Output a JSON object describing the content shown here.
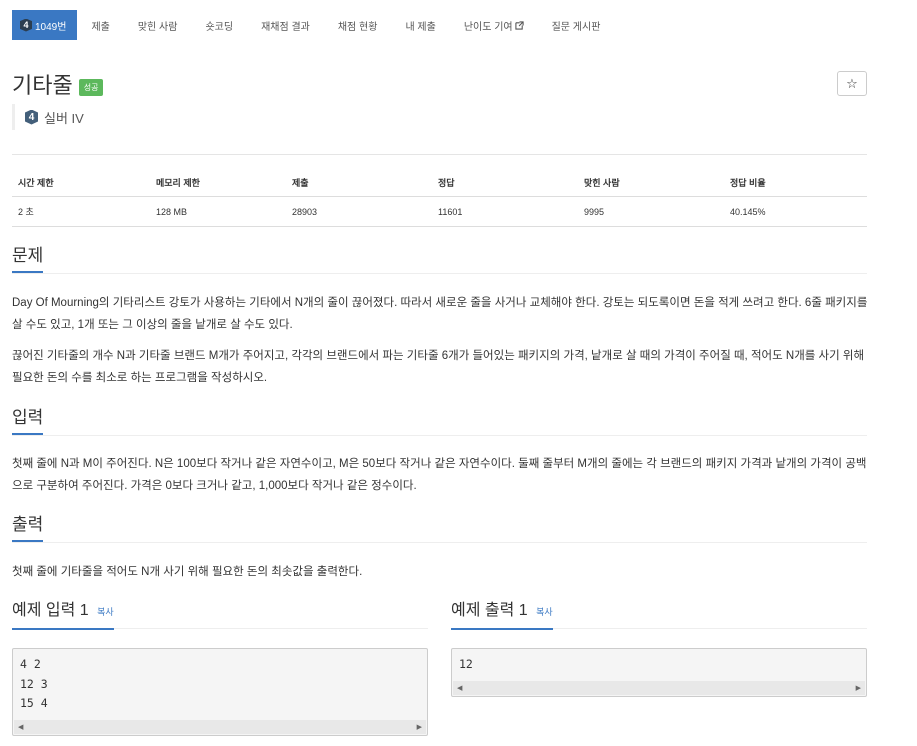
{
  "tabs": [
    {
      "label": "1049번",
      "tier_num": "4",
      "active": true
    },
    {
      "label": "제출"
    },
    {
      "label": "맞힌 사람"
    },
    {
      "label": "숏코딩"
    },
    {
      "label": "재채점 결과"
    },
    {
      "label": "채점 현황"
    },
    {
      "label": "내 제출"
    },
    {
      "label": "난이도 기여",
      "external": true
    },
    {
      "label": "질문 게시판"
    }
  ],
  "problem": {
    "title": "기타줄",
    "result_label": "성공",
    "tier_num": "4",
    "tier_label": "실버 IV",
    "favorite_icon": "☆"
  },
  "info_table": {
    "headers": [
      "시간 제한",
      "메모리 제한",
      "제출",
      "정답",
      "맞힌 사람",
      "정답 비율"
    ],
    "row": [
      "2 초",
      "128 MB",
      "28903",
      "11601",
      "9995",
      "40.145%"
    ]
  },
  "sections": {
    "problem_heading": "문제",
    "problem_p1": "Day Of Mourning의 기타리스트 강토가 사용하는 기타에서 N개의 줄이 끊어졌다. 따라서 새로운 줄을 사거나 교체해야 한다. 강토는 되도록이면 돈을 적게 쓰려고 한다. 6줄 패키지를 살 수도 있고, 1개 또는 그 이상의 줄을 낱개로 살 수도 있다.",
    "problem_p2": "끊어진 기타줄의 개수 N과 기타줄 브랜드 M개가 주어지고, 각각의 브랜드에서 파는 기타줄 6개가 들어있는 패키지의 가격, 낱개로 살 때의 가격이 주어질 때, 적어도 N개를 사기 위해 필요한 돈의 수를 최소로 하는 프로그램을 작성하시오.",
    "input_heading": "입력",
    "input_p": "첫째 줄에 N과 M이 주어진다. N은 100보다 작거나 같은 자연수이고, M은 50보다 작거나 같은 자연수이다. 둘째 줄부터 M개의 줄에는 각 브랜드의 패키지 가격과 낱개의 가격이 공백으로 구분하여 주어진다. 가격은 0보다 크거나 같고, 1,000보다 작거나 같은 정수이다.",
    "output_heading": "출력",
    "output_p": "첫째 줄에 기타줄을 적어도 N개 사기 위해 필요한 돈의 최솟값을 출력한다."
  },
  "samples": {
    "input_heading": "예제 입력 1",
    "output_heading": "예제 출력 1",
    "copy_label": "복사",
    "input_text": "4 2\n12 3\n15 4",
    "output_text": "12"
  }
}
